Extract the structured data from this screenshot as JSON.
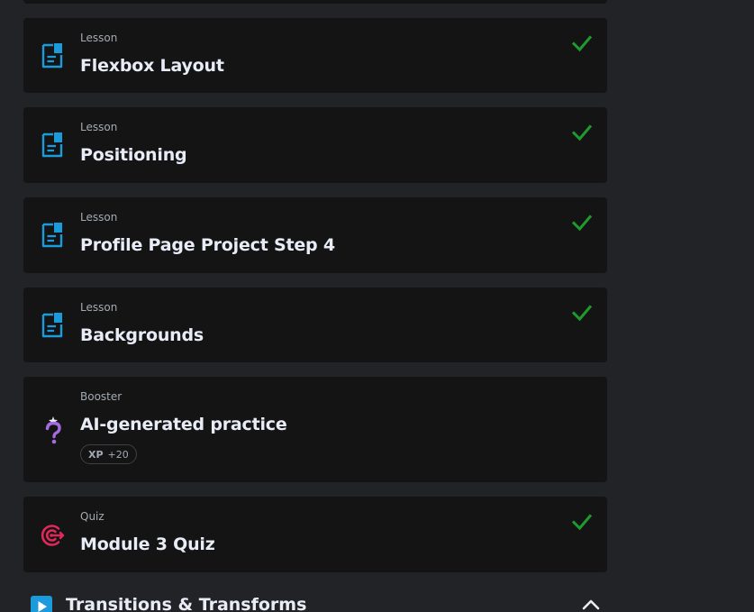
{
  "items": [
    {
      "type": "Lesson",
      "title": "Flexbox Layout",
      "icon": "lesson-document-icon",
      "completed": true
    },
    {
      "type": "Lesson",
      "title": "Positioning",
      "icon": "lesson-document-icon",
      "completed": true
    },
    {
      "type": "Lesson",
      "title": "Profile Page Project Step 4",
      "icon": "lesson-document-icon",
      "completed": true
    },
    {
      "type": "Lesson",
      "title": "Backgrounds",
      "icon": "lesson-document-icon",
      "completed": true
    },
    {
      "type": "Booster",
      "title": "AI-generated practice",
      "icon": "booster-question-icon",
      "completed": false,
      "xp_label": "XP",
      "xp_value": "+20"
    },
    {
      "type": "Quiz",
      "title": "Module 3 Quiz",
      "icon": "quiz-target-icon",
      "completed": true
    }
  ],
  "section": {
    "title": "Transitions & Transforms",
    "icon": "play-icon",
    "expanded": true
  },
  "colors": {
    "background": "#222326",
    "card": "#141414",
    "lesson_icon": "#1b9bdc",
    "check": "#1f9a2f",
    "booster_icon": "#a66be0",
    "quiz_icon": "#e0295a",
    "title_text": "#e8ecf6",
    "meta_text": "#a4aab4"
  }
}
